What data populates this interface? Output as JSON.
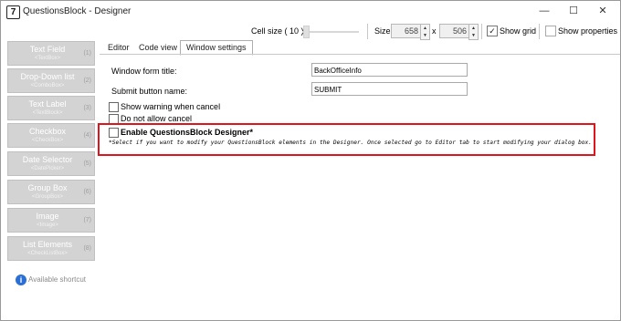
{
  "window": {
    "title": "QuestionsBlock - Designer",
    "app_icon_glyph": "7",
    "controls": {
      "minimize": "—",
      "maximize": "☐",
      "close": "✕"
    }
  },
  "toolbar": {
    "cell_size_label": "Cell size ( 10 )",
    "size_label": "Size:",
    "width_value": "658",
    "x_label": "x",
    "height_value": "506",
    "show_grid_label": "Show grid",
    "show_grid_checked": "✓",
    "show_properties_label": "Show properties"
  },
  "elements": [
    {
      "name": "Text Field",
      "type": "<TextBox>",
      "key": "(1)"
    },
    {
      "name": "Drop-Down list",
      "type": "<ComboBox>",
      "key": "(2)"
    },
    {
      "name": "Text Label",
      "type": "<TextBlock>",
      "key": "(3)"
    },
    {
      "name": "Checkbox",
      "type": "<CheckBox>",
      "key": "(4)"
    },
    {
      "name": "Date Selector",
      "type": "<DatePicker>",
      "key": "(5)"
    },
    {
      "name": "Group Box",
      "type": "<GroupBox>",
      "key": "(6)"
    },
    {
      "name": "Image",
      "type": "<Image>",
      "key": "(7)"
    },
    {
      "name": "List Elements",
      "type": "<CheckListBox>",
      "key": "(8)"
    }
  ],
  "available_shortcut": "Available shortcut",
  "tabs": [
    "Editor",
    "Code view",
    "Window settings"
  ],
  "settings": {
    "form_title_label": "Window form title:",
    "form_title_value": "BackOfficeInfo",
    "submit_label": "Submit button name:",
    "submit_value": "SUBMIT",
    "show_warning_label": "Show warning when cancel",
    "no_cancel_label": "Do not allow cancel",
    "enable_designer_label": "Enable QuestionsBlock Designer*",
    "enable_designer_desc": "*Select if you want to modify your QuestionsBlock elements in the Designer. Once selected go to Editor tab to start modifying your dialog box."
  },
  "colors": {
    "highlight": "#e0141c",
    "info": "#2a6fd6"
  }
}
